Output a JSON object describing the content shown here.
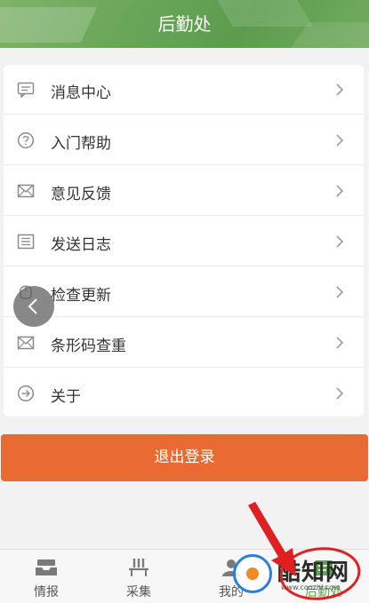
{
  "header": {
    "title": "后勤处",
    "color": "#6aa65a"
  },
  "menu": {
    "items": [
      {
        "label": "消息中心",
        "icon": "message-icon"
      },
      {
        "label": "入门帮助",
        "icon": "help-icon"
      },
      {
        "label": "意见反馈",
        "icon": "mail-icon"
      },
      {
        "label": "发送日志",
        "icon": "log-icon"
      },
      {
        "label": "检查更新",
        "icon": "update-icon"
      },
      {
        "label": "条形码查重",
        "icon": "mail-icon"
      },
      {
        "label": "关于",
        "icon": "about-icon"
      }
    ]
  },
  "logout": {
    "label": "退出登录",
    "color": "#ea6a33"
  },
  "nav": {
    "items": [
      {
        "label": "情报",
        "icon": "inbox-icon"
      },
      {
        "label": "采集",
        "icon": "collect-icon"
      },
      {
        "label": "我的",
        "icon": "user-icon"
      },
      {
        "label": "后勤处",
        "icon": "logistics-icon"
      }
    ]
  },
  "watermark": {
    "name": "酷知网",
    "url": "www.coozhi.com"
  },
  "annotation_color": "#e02020"
}
